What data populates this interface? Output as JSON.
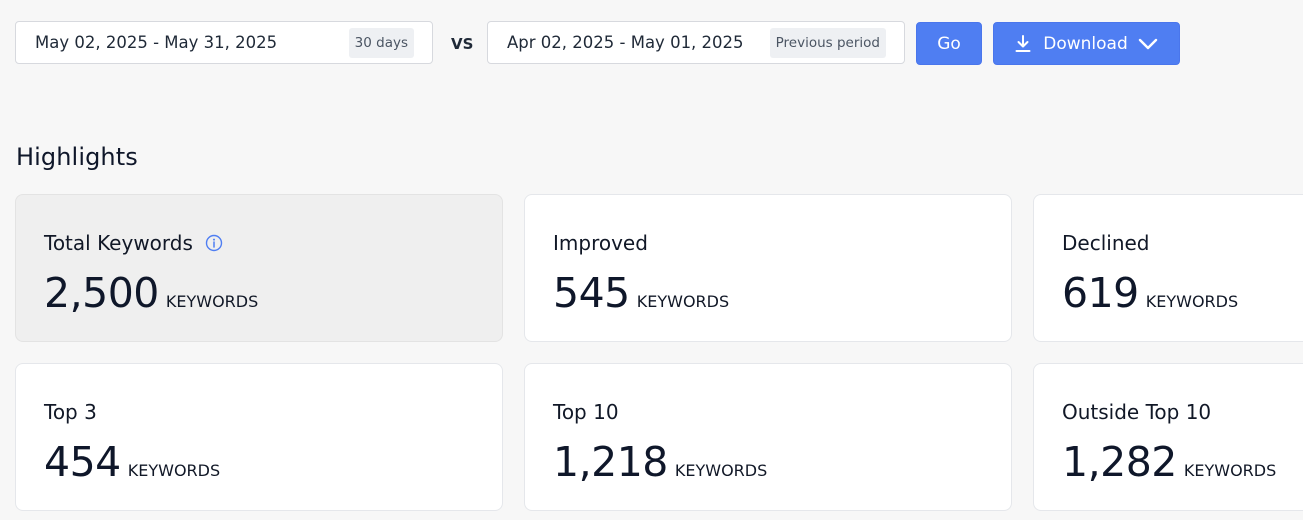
{
  "date_filter": {
    "current": {
      "range": "May 02, 2025 - May 31, 2025",
      "badge": "30 days"
    },
    "vs_label": "VS",
    "previous": {
      "range": "Apr 02, 2025 - May 01, 2025",
      "badge": "Previous period"
    },
    "go_label": "Go",
    "download_label": "Download",
    "accent_color": "#4f7ef2"
  },
  "highlights": {
    "title": "Highlights",
    "cards": [
      {
        "label": "Total Keywords",
        "value": "2,500",
        "unit": "KEYWORDS",
        "info_icon": "info-circle-icon",
        "selected": true
      },
      {
        "label": "Improved",
        "value": "545",
        "unit": "KEYWORDS"
      },
      {
        "label": "Declined",
        "value": "619",
        "unit": "KEYWORDS"
      },
      {
        "label": "Top 3",
        "value": "454",
        "unit": "KEYWORDS"
      },
      {
        "label": "Top 10",
        "value": "1,218",
        "unit": "KEYWORDS"
      },
      {
        "label": "Outside Top 10",
        "value": "1,282",
        "unit": "KEYWORDS"
      }
    ]
  }
}
